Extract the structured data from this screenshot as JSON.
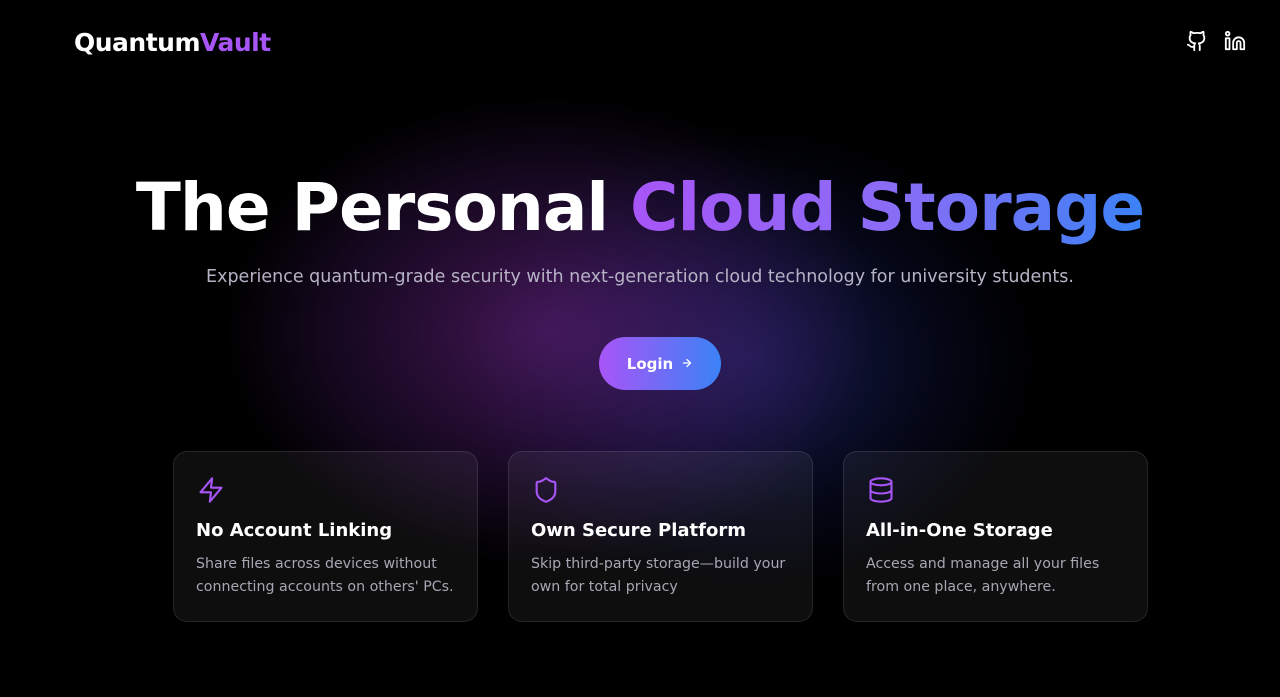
{
  "header": {
    "logo_primary": "Quantum",
    "logo_accent": "Vault",
    "social": [
      {
        "icon": "github-icon"
      },
      {
        "icon": "linkedin-icon"
      }
    ]
  },
  "hero": {
    "title_plain": "The Personal",
    "title_gradient": "Cloud Storage",
    "subtitle": "Experience quantum-grade security with next-generation cloud technology for university students.",
    "login_label": "Login"
  },
  "features": [
    {
      "icon": "lightning-icon",
      "title": "No Account Linking",
      "description": "Share files across devices without connecting accounts on others' PCs."
    },
    {
      "icon": "shield-icon",
      "title": "Own Secure Platform",
      "description": "Skip third-party storage—build your own for total privacy"
    },
    {
      "icon": "database-icon",
      "title": "All-in-One Storage",
      "description": "Access and manage all your files from one place, anywhere."
    }
  ],
  "colors": {
    "accent_purple": "#a855f7",
    "accent_blue": "#3b82f6",
    "background": "#000000"
  }
}
